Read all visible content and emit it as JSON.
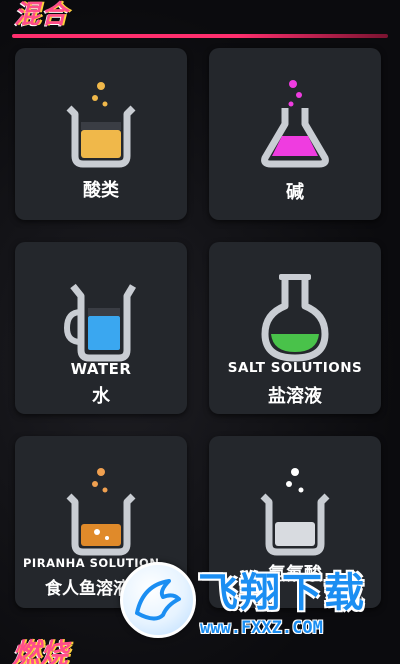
{
  "header": {
    "title": "混合"
  },
  "footer": {
    "title": "燃烧"
  },
  "cards": [
    {
      "id": "acids",
      "label_en": "",
      "label_cn": "酸类",
      "icon": "beaker-icon",
      "liquid_color": "#f0b84a",
      "bubble_color": "#f0b84a"
    },
    {
      "id": "bases",
      "label_en": "",
      "label_cn": "碱",
      "icon": "flask-icon",
      "liquid_color": "#ef3ce0",
      "bubble_color": "#ef3ce0"
    },
    {
      "id": "water",
      "label_en": "WATER",
      "label_cn": "水",
      "icon": "pitcher-icon",
      "liquid_color": "#3aa7f0"
    },
    {
      "id": "salt",
      "label_en": "SALT SOLUTIONS",
      "label_cn": "盐溶液",
      "icon": "round-flask-icon",
      "liquid_color": "#49c24a"
    },
    {
      "id": "piranha",
      "label_en": "PIRANHA SOLUTION",
      "label_cn": "食人鱼溶液",
      "icon": "beaker-icon",
      "liquid_color": "#e08a2a",
      "bubble_color": "#f0a050"
    },
    {
      "id": "hf",
      "label_en": "",
      "label_cn": "氢氟酸",
      "icon": "beaker-icon",
      "liquid_color": "#d8dbe0",
      "bubble_color": "#ffffff"
    }
  ],
  "watermark": {
    "main": "飞翔下载",
    "url": "www.FXXZ.COM"
  }
}
